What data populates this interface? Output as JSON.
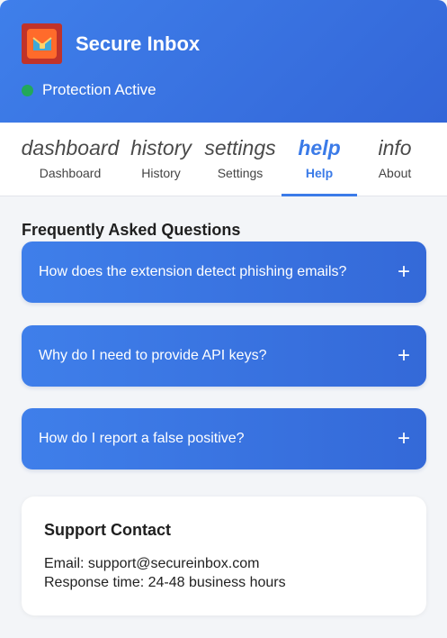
{
  "header": {
    "title": "Secure Inbox",
    "status_text": "Protection Active",
    "status_color": "#22a85a",
    "logo_icon": "envelope-shield-icon"
  },
  "tabs": [
    {
      "icon": "dashboard",
      "label": "Dashboard",
      "active": false
    },
    {
      "icon": "history",
      "label": "History",
      "active": false
    },
    {
      "icon": "settings",
      "label": "Settings",
      "active": false
    },
    {
      "icon": "help",
      "label": "Help",
      "active": true
    },
    {
      "icon": "info",
      "label": "About",
      "active": false
    }
  ],
  "faq": {
    "title": "Frequently Asked Questions",
    "expand_symbol": "+",
    "items": [
      {
        "question": "How does the extension detect phishing emails?"
      },
      {
        "question": "Why do I need to provide API keys?"
      },
      {
        "question": "How do I report a false positive?"
      }
    ]
  },
  "support": {
    "title": "Support Contact",
    "email_line": "Email: support@secureinbox.com",
    "response_line": "Response time: 24-48 business hours"
  },
  "colors": {
    "accent": "#3b7be8",
    "header_gradient_start": "#3f7fea",
    "header_gradient_end": "#3366d8"
  }
}
